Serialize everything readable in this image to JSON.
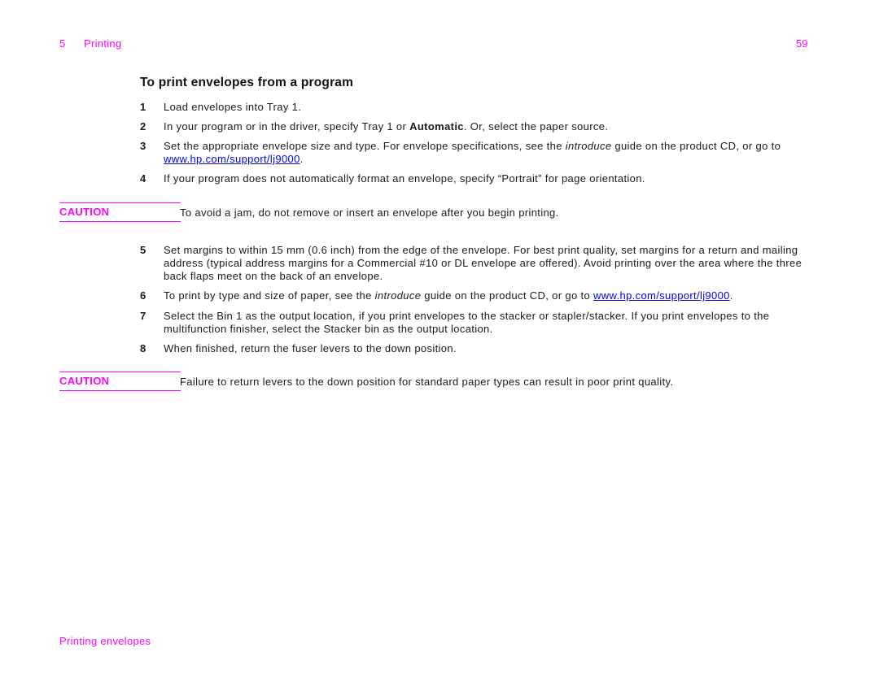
{
  "header": {
    "chapter_number": "5",
    "chapter_title": "Printing",
    "page_number": "59"
  },
  "section": {
    "title": "To print envelopes from a program"
  },
  "steps": [
    {
      "num": "1",
      "text": "Load envelopes into Tray 1."
    },
    {
      "num": "2",
      "pre": "In your program or in the driver, specify Tray 1 or ",
      "bold": "Automatic",
      "post": ". Or, select the paper source."
    },
    {
      "num": "3",
      "pre": "Set the appropriate envelope size and type. For envelope specifications, see the ",
      "italic": "introduce",
      "mid": " guide on the product CD, or go to ",
      "link": "www.hp.com/support/lj9000",
      "post": "."
    },
    {
      "num": "4",
      "text": "If your program does not automatically format an envelope, specify “Portrait” for page orientation."
    },
    {
      "num": "5",
      "text": "Set margins to within 15 mm (0.6 inch) from the edge of the envelope. For best print quality, set margins for a return and mailing address (typical address margins for a Commercial #10 or DL envelope are offered). Avoid printing over the area where the three back flaps meet on the back of an envelope."
    },
    {
      "num": "6",
      "pre": "To print by type and size of paper, see the ",
      "italic": "introduce",
      "mid": " guide on the product CD, or go to ",
      "link": "www.hp.com/support/lj9000",
      "post": "."
    },
    {
      "num": "7",
      "text": "Select the Bin 1 as the output location, if you print envelopes to the stacker or stapler/stacker. If you print envelopes to the multifunction finisher, select the Stacker bin as the output location."
    },
    {
      "num": "8",
      "text": "When finished, return the fuser levers to the down position."
    }
  ],
  "cautions": [
    {
      "label": "CAUTION",
      "text": "To avoid a jam, do not remove or insert an envelope after you begin printing."
    },
    {
      "label": "CAUTION",
      "text": "Failure to return levers to the down position for standard paper types can result in poor print quality."
    }
  ],
  "footer": {
    "text": "Printing envelopes"
  },
  "colors": {
    "accent": "#ff00ff",
    "link": "#0000ee",
    "text": "#1a1a1a"
  }
}
